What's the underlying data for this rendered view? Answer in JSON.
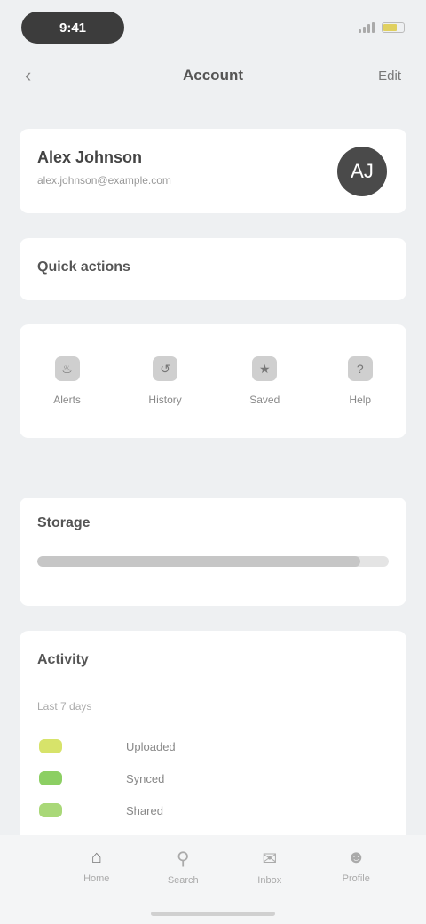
{
  "status": {
    "time": "9:41",
    "battery_level": 0.7,
    "battery_color": "#e0d060"
  },
  "nav": {
    "back_icon": "chevron-left-icon",
    "title": "Account",
    "action": "Edit"
  },
  "profile": {
    "name": "Alex Johnson",
    "subtitle": "alex.johnson@example.com",
    "avatar_initials": "AJ"
  },
  "quick": {
    "title": "Quick actions"
  },
  "shortcuts": [
    {
      "icon": "bell-icon",
      "label": "Alerts"
    },
    {
      "icon": "history-icon",
      "label": "History"
    },
    {
      "icon": "star-icon",
      "label": "Saved"
    },
    {
      "icon": "help-icon",
      "label": "Help"
    }
  ],
  "storage": {
    "title": "Storage",
    "used_fraction": 0.92
  },
  "activity": {
    "title": "Activity",
    "subtitle": "Last 7 days",
    "items": [
      {
        "label": "Uploaded",
        "color": "#d7e36a"
      },
      {
        "label": "Synced",
        "color": "#8ccf63"
      },
      {
        "label": "Shared",
        "color": "#a9d878"
      }
    ]
  },
  "tabs": [
    {
      "label": "Home",
      "icon": "home-icon",
      "active": true
    },
    {
      "label": "Search",
      "icon": "search-icon",
      "active": false
    },
    {
      "label": "Inbox",
      "icon": "inbox-icon",
      "active": false
    },
    {
      "label": "Profile",
      "icon": "user-icon",
      "active": false
    }
  ]
}
